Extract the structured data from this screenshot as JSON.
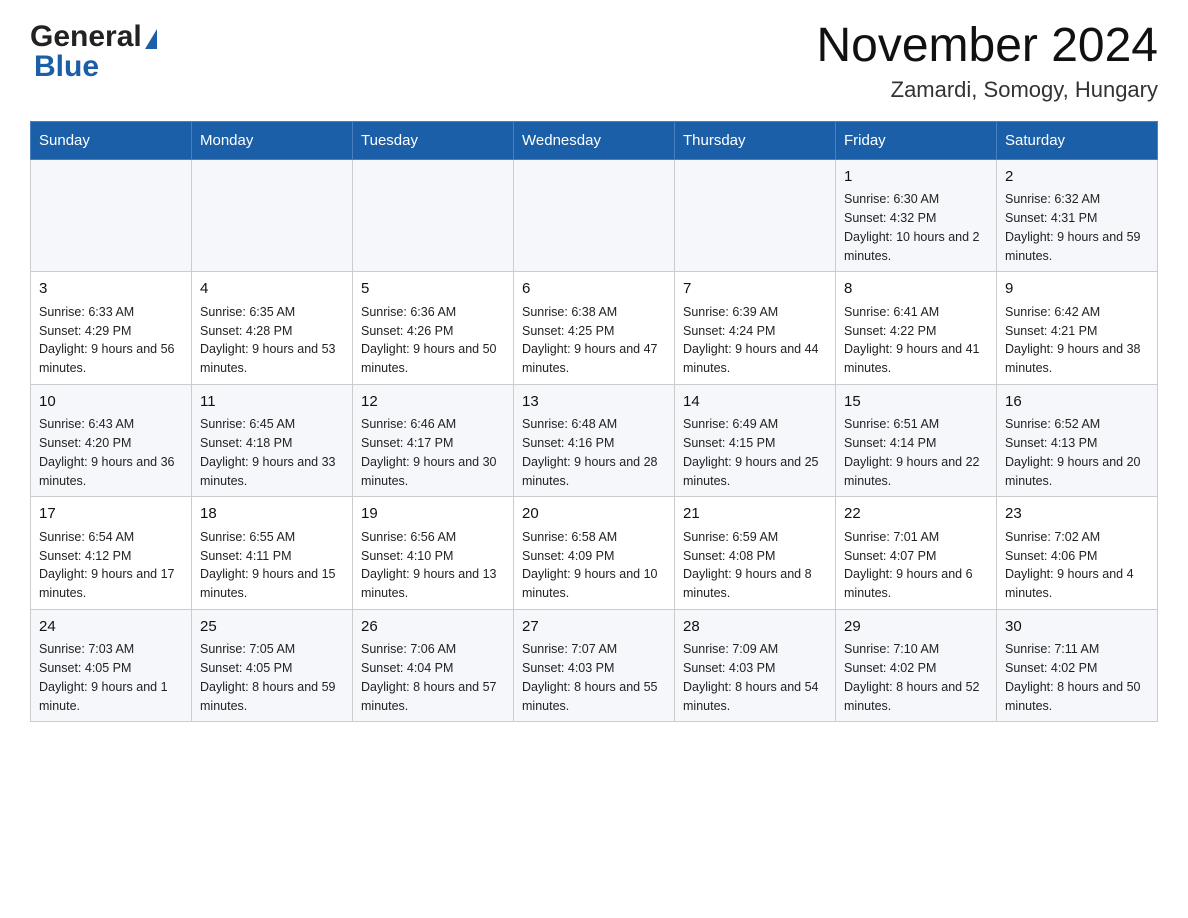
{
  "header": {
    "logo_general": "General",
    "logo_blue": "Blue",
    "month_year": "November 2024",
    "location": "Zamardi, Somogy, Hungary"
  },
  "days_of_week": [
    "Sunday",
    "Monday",
    "Tuesday",
    "Wednesday",
    "Thursday",
    "Friday",
    "Saturday"
  ],
  "weeks": [
    [
      {
        "day": "",
        "info": ""
      },
      {
        "day": "",
        "info": ""
      },
      {
        "day": "",
        "info": ""
      },
      {
        "day": "",
        "info": ""
      },
      {
        "day": "",
        "info": ""
      },
      {
        "day": "1",
        "info": "Sunrise: 6:30 AM\nSunset: 4:32 PM\nDaylight: 10 hours and 2 minutes."
      },
      {
        "day": "2",
        "info": "Sunrise: 6:32 AM\nSunset: 4:31 PM\nDaylight: 9 hours and 59 minutes."
      }
    ],
    [
      {
        "day": "3",
        "info": "Sunrise: 6:33 AM\nSunset: 4:29 PM\nDaylight: 9 hours and 56 minutes."
      },
      {
        "day": "4",
        "info": "Sunrise: 6:35 AM\nSunset: 4:28 PM\nDaylight: 9 hours and 53 minutes."
      },
      {
        "day": "5",
        "info": "Sunrise: 6:36 AM\nSunset: 4:26 PM\nDaylight: 9 hours and 50 minutes."
      },
      {
        "day": "6",
        "info": "Sunrise: 6:38 AM\nSunset: 4:25 PM\nDaylight: 9 hours and 47 minutes."
      },
      {
        "day": "7",
        "info": "Sunrise: 6:39 AM\nSunset: 4:24 PM\nDaylight: 9 hours and 44 minutes."
      },
      {
        "day": "8",
        "info": "Sunrise: 6:41 AM\nSunset: 4:22 PM\nDaylight: 9 hours and 41 minutes."
      },
      {
        "day": "9",
        "info": "Sunrise: 6:42 AM\nSunset: 4:21 PM\nDaylight: 9 hours and 38 minutes."
      }
    ],
    [
      {
        "day": "10",
        "info": "Sunrise: 6:43 AM\nSunset: 4:20 PM\nDaylight: 9 hours and 36 minutes."
      },
      {
        "day": "11",
        "info": "Sunrise: 6:45 AM\nSunset: 4:18 PM\nDaylight: 9 hours and 33 minutes."
      },
      {
        "day": "12",
        "info": "Sunrise: 6:46 AM\nSunset: 4:17 PM\nDaylight: 9 hours and 30 minutes."
      },
      {
        "day": "13",
        "info": "Sunrise: 6:48 AM\nSunset: 4:16 PM\nDaylight: 9 hours and 28 minutes."
      },
      {
        "day": "14",
        "info": "Sunrise: 6:49 AM\nSunset: 4:15 PM\nDaylight: 9 hours and 25 minutes."
      },
      {
        "day": "15",
        "info": "Sunrise: 6:51 AM\nSunset: 4:14 PM\nDaylight: 9 hours and 22 minutes."
      },
      {
        "day": "16",
        "info": "Sunrise: 6:52 AM\nSunset: 4:13 PM\nDaylight: 9 hours and 20 minutes."
      }
    ],
    [
      {
        "day": "17",
        "info": "Sunrise: 6:54 AM\nSunset: 4:12 PM\nDaylight: 9 hours and 17 minutes."
      },
      {
        "day": "18",
        "info": "Sunrise: 6:55 AM\nSunset: 4:11 PM\nDaylight: 9 hours and 15 minutes."
      },
      {
        "day": "19",
        "info": "Sunrise: 6:56 AM\nSunset: 4:10 PM\nDaylight: 9 hours and 13 minutes."
      },
      {
        "day": "20",
        "info": "Sunrise: 6:58 AM\nSunset: 4:09 PM\nDaylight: 9 hours and 10 minutes."
      },
      {
        "day": "21",
        "info": "Sunrise: 6:59 AM\nSunset: 4:08 PM\nDaylight: 9 hours and 8 minutes."
      },
      {
        "day": "22",
        "info": "Sunrise: 7:01 AM\nSunset: 4:07 PM\nDaylight: 9 hours and 6 minutes."
      },
      {
        "day": "23",
        "info": "Sunrise: 7:02 AM\nSunset: 4:06 PM\nDaylight: 9 hours and 4 minutes."
      }
    ],
    [
      {
        "day": "24",
        "info": "Sunrise: 7:03 AM\nSunset: 4:05 PM\nDaylight: 9 hours and 1 minute."
      },
      {
        "day": "25",
        "info": "Sunrise: 7:05 AM\nSunset: 4:05 PM\nDaylight: 8 hours and 59 minutes."
      },
      {
        "day": "26",
        "info": "Sunrise: 7:06 AM\nSunset: 4:04 PM\nDaylight: 8 hours and 57 minutes."
      },
      {
        "day": "27",
        "info": "Sunrise: 7:07 AM\nSunset: 4:03 PM\nDaylight: 8 hours and 55 minutes."
      },
      {
        "day": "28",
        "info": "Sunrise: 7:09 AM\nSunset: 4:03 PM\nDaylight: 8 hours and 54 minutes."
      },
      {
        "day": "29",
        "info": "Sunrise: 7:10 AM\nSunset: 4:02 PM\nDaylight: 8 hours and 52 minutes."
      },
      {
        "day": "30",
        "info": "Sunrise: 7:11 AM\nSunset: 4:02 PM\nDaylight: 8 hours and 50 minutes."
      }
    ]
  ]
}
